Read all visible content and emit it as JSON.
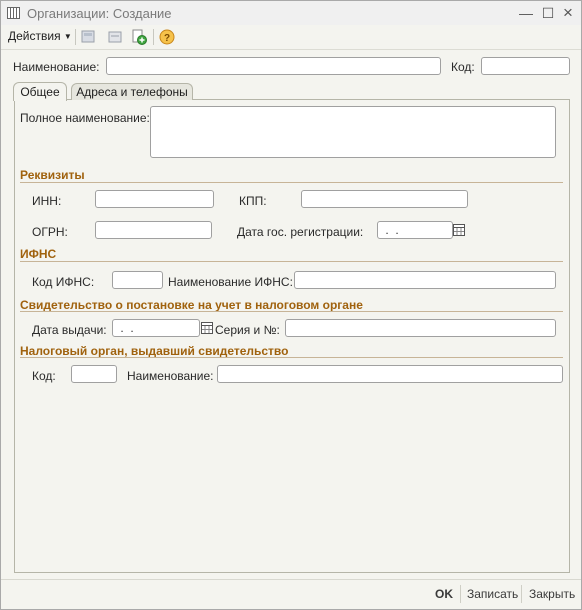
{
  "window": {
    "title": "Организации: Создание",
    "buttons": {
      "close": "×",
      "maximize": "☐",
      "minimize": "—"
    }
  },
  "toolbar": {
    "actions_label": "Действия",
    "icons": [
      "record-icon",
      "copy-icon",
      "add-icon",
      "help-icon"
    ]
  },
  "header": {
    "name_label": "Наименование:",
    "name_value": "",
    "code_label": "Код:",
    "code_value": ""
  },
  "tabs": [
    {
      "label": "Общее",
      "active": true
    },
    {
      "label": "Адреса и телефоны",
      "active": false
    }
  ],
  "general": {
    "full_name_label": "Полное наименование:",
    "full_name_value": "",
    "requisites": {
      "title": "Реквизиты",
      "inn_label": "ИНН:",
      "kpp_label": "КПП:",
      "ogrn_label": "ОГРН:",
      "reg_date_label": "Дата гос. регистрации:",
      "reg_date_value": " .  ."
    },
    "ifns": {
      "title": "ИФНС",
      "code_label": "Код ИФНС:",
      "name_label": "Наименование ИФНС:"
    },
    "certificate": {
      "title": "Свидетельство о постановке на учет в налоговом органе",
      "issue_date_label": "Дата выдачи:",
      "issue_date_value": " .  .",
      "series_label": "Серия и №:"
    },
    "tax_authority": {
      "title": "Налоговый орган, выдавший свидетельство",
      "code_label": "Код:",
      "name_label": "Наименование:"
    }
  },
  "footer": {
    "ok_label": "OK",
    "save_label": "Записать",
    "close_label": "Закрыть"
  },
  "colors": {
    "section_title": "#a0620e",
    "background": "#f4f4ef",
    "input_border": "#a0a0a0"
  }
}
